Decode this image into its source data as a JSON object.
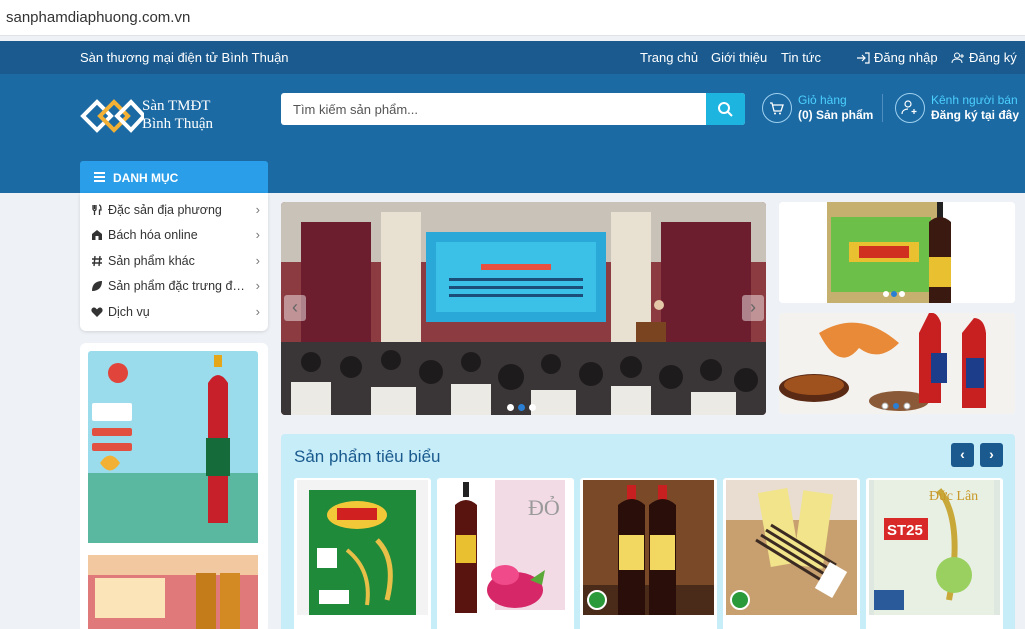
{
  "browser": {
    "url": "sanphamdiaphuong.com.vn"
  },
  "topbar": {
    "site_name": "Sàn thương mại điện tử Bình Thuận",
    "nav": [
      "Trang chủ",
      "Giới thiệu",
      "Tin tức"
    ],
    "login": "Đăng nhập",
    "register": "Đăng ký"
  },
  "header": {
    "logo_line1": "Sàn TMĐT",
    "logo_line2": "Bình Thuận",
    "search_placeholder": "Tìm kiếm sản phẩm...",
    "cart_label": "Giỏ hàng",
    "cart_count": "(0) Sản phẩm",
    "seller_label": "Kênh người bán",
    "seller_action": "Đăng ký tại đây"
  },
  "categories": {
    "heading": "DANH MỤC",
    "items": [
      {
        "label": "Đặc sản địa phương",
        "icon": "utensils-icon"
      },
      {
        "label": "Bách hóa online",
        "icon": "store-icon"
      },
      {
        "label": "Sản phẩm khác",
        "icon": "hashtag-icon"
      },
      {
        "label": "Sản phẩm đặc trưng địa phương",
        "icon": "leaf-icon"
      },
      {
        "label": "Dịch vụ",
        "icon": "heart-icon"
      }
    ]
  },
  "banner": {
    "slide_count": 3,
    "active_slide": 2
  },
  "right_ads": {
    "dots_active": 2
  },
  "featured": {
    "title": "Sản phẩm tiêu biểu",
    "products": [
      "rice-bag",
      "dragon-fruit-sauce",
      "fish-sauce-bottles",
      "incense-sticks",
      "st25-rice"
    ]
  },
  "colors": {
    "topbar": "#1a5a8e",
    "header": "#1b6aa3",
    "accent": "#2a9ee8",
    "search_btn": "#1db5e0"
  }
}
